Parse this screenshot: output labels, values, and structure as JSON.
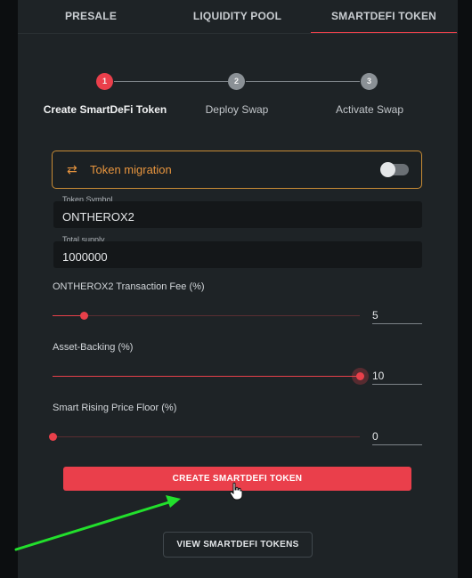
{
  "tabs": [
    {
      "label": "PRESALE"
    },
    {
      "label": "LIQUIDITY POOL"
    },
    {
      "label": "SMARTDEFI TOKEN"
    }
  ],
  "stepper": {
    "steps": [
      {
        "number": "1",
        "label": "Create SmartDeFi Token"
      },
      {
        "number": "2",
        "label": "Deploy Swap"
      },
      {
        "number": "3",
        "label": "Activate Swap"
      }
    ]
  },
  "migration": {
    "label": "Token migration",
    "icon": "swap-arrows-icon",
    "enabled": false
  },
  "fields": {
    "token_symbol": {
      "label": "Token Symbol",
      "value": "ONTHEROX2"
    },
    "total_supply": {
      "label": "Total supply",
      "value": "1000000"
    }
  },
  "sliders": {
    "fee": {
      "label": "ONTHEROX2 Transaction Fee (%)",
      "value": "5"
    },
    "asset_backing": {
      "label": "Asset-Backing (%)",
      "value": "10"
    },
    "price_floor": {
      "label": "Smart Rising Price Floor (%)",
      "value": "0"
    }
  },
  "buttons": {
    "create": "CREATE SMARTDEFI TOKEN",
    "view": "VIEW SMARTDEFI TOKENS"
  },
  "colors": {
    "accent": "#ea3f4b",
    "warning": "#e8953e",
    "panel": "#1e2326",
    "annotation_arrow": "#22e02c"
  }
}
